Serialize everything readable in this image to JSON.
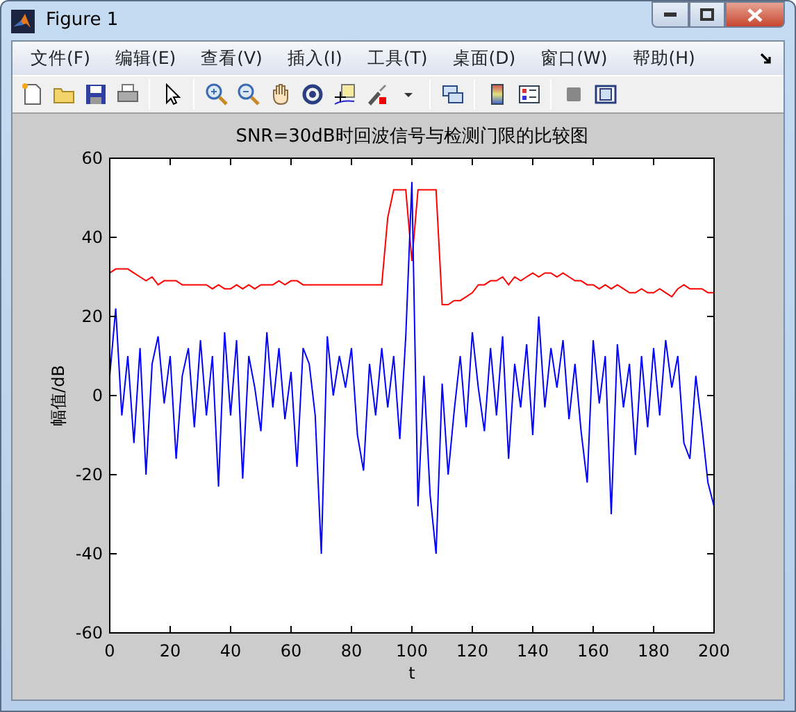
{
  "window": {
    "title": "Figure 1"
  },
  "menu": [
    "文件(F)",
    "编辑(E)",
    "查看(V)",
    "插入(I)",
    "工具(T)",
    "桌面(D)",
    "窗口(W)",
    "帮助(H)"
  ],
  "figure": {
    "chart_data": {
      "type": "line",
      "title": "SNR=30dB时回波信号与检测门限的比较图",
      "xlabel": "t",
      "ylabel": "幅值/dB",
      "xlim": [
        0,
        200
      ],
      "ylim": [
        -60,
        60
      ],
      "xticks": [
        0,
        20,
        40,
        60,
        80,
        100,
        120,
        140,
        160,
        180,
        200
      ],
      "yticks": [
        -60,
        -40,
        -20,
        0,
        20,
        40,
        60
      ],
      "x": [
        0,
        2,
        4,
        6,
        8,
        10,
        12,
        14,
        16,
        18,
        20,
        22,
        24,
        26,
        28,
        30,
        32,
        34,
        36,
        38,
        40,
        42,
        44,
        46,
        48,
        50,
        52,
        54,
        56,
        58,
        60,
        62,
        64,
        66,
        68,
        70,
        72,
        74,
        76,
        78,
        80,
        82,
        84,
        86,
        88,
        90,
        92,
        94,
        96,
        98,
        100,
        102,
        104,
        106,
        108,
        110,
        112,
        114,
        116,
        118,
        120,
        122,
        124,
        126,
        128,
        130,
        132,
        134,
        136,
        138,
        140,
        142,
        144,
        146,
        148,
        150,
        152,
        154,
        156,
        158,
        160,
        162,
        164,
        166,
        168,
        170,
        172,
        174,
        176,
        178,
        180,
        182,
        184,
        186,
        188,
        190,
        192,
        194,
        196,
        198,
        200
      ],
      "series": [
        {
          "color": "#ff0000",
          "values": [
            31,
            32,
            32,
            32,
            31,
            30,
            29,
            30,
            28,
            29,
            29,
            29,
            28,
            28,
            28,
            28,
            28,
            27,
            28,
            27,
            27,
            28,
            27,
            28,
            27,
            28,
            28,
            28,
            29,
            28,
            29,
            29,
            28,
            28,
            28,
            28,
            28,
            28,
            28,
            28,
            28,
            28,
            28,
            28,
            28,
            28,
            45,
            52,
            52,
            52,
            34,
            52,
            52,
            52,
            52,
            23,
            23,
            24,
            24,
            25,
            26,
            28,
            28,
            29,
            29,
            30,
            28,
            30,
            29,
            30,
            31,
            30,
            31,
            31,
            30,
            31,
            30,
            29,
            29,
            28,
            28,
            27,
            28,
            27,
            28,
            27,
            26,
            26,
            27,
            26,
            26,
            27,
            26,
            25,
            27,
            28,
            27,
            27,
            27,
            26,
            26
          ]
        },
        {
          "color": "#0000ff",
          "values": [
            5,
            22,
            -5,
            10,
            -12,
            12,
            -20,
            8,
            15,
            -2,
            10,
            -16,
            5,
            12,
            -8,
            14,
            -5,
            10,
            -23,
            16,
            -5,
            14,
            -21,
            10,
            2,
            -9,
            16,
            -3,
            12,
            -6,
            6,
            -18,
            12,
            8,
            -5,
            -40,
            15,
            0,
            10,
            2,
            12,
            -10,
            -19,
            8,
            -5,
            12,
            -3,
            10,
            -11,
            15,
            54,
            -28,
            5,
            -25,
            -40,
            3,
            -20,
            -4,
            10,
            -8,
            16,
            2,
            -9,
            12,
            -5,
            15,
            -16,
            8,
            -3,
            13,
            -10,
            20,
            -3,
            12,
            2,
            14,
            -6,
            8,
            -9,
            -22,
            14,
            -2,
            10,
            -30,
            13,
            -3,
            8,
            -15,
            10,
            -8,
            12,
            -5,
            14,
            2,
            10,
            -12,
            -16,
            5,
            -8,
            -22,
            -28
          ]
        }
      ]
    }
  }
}
